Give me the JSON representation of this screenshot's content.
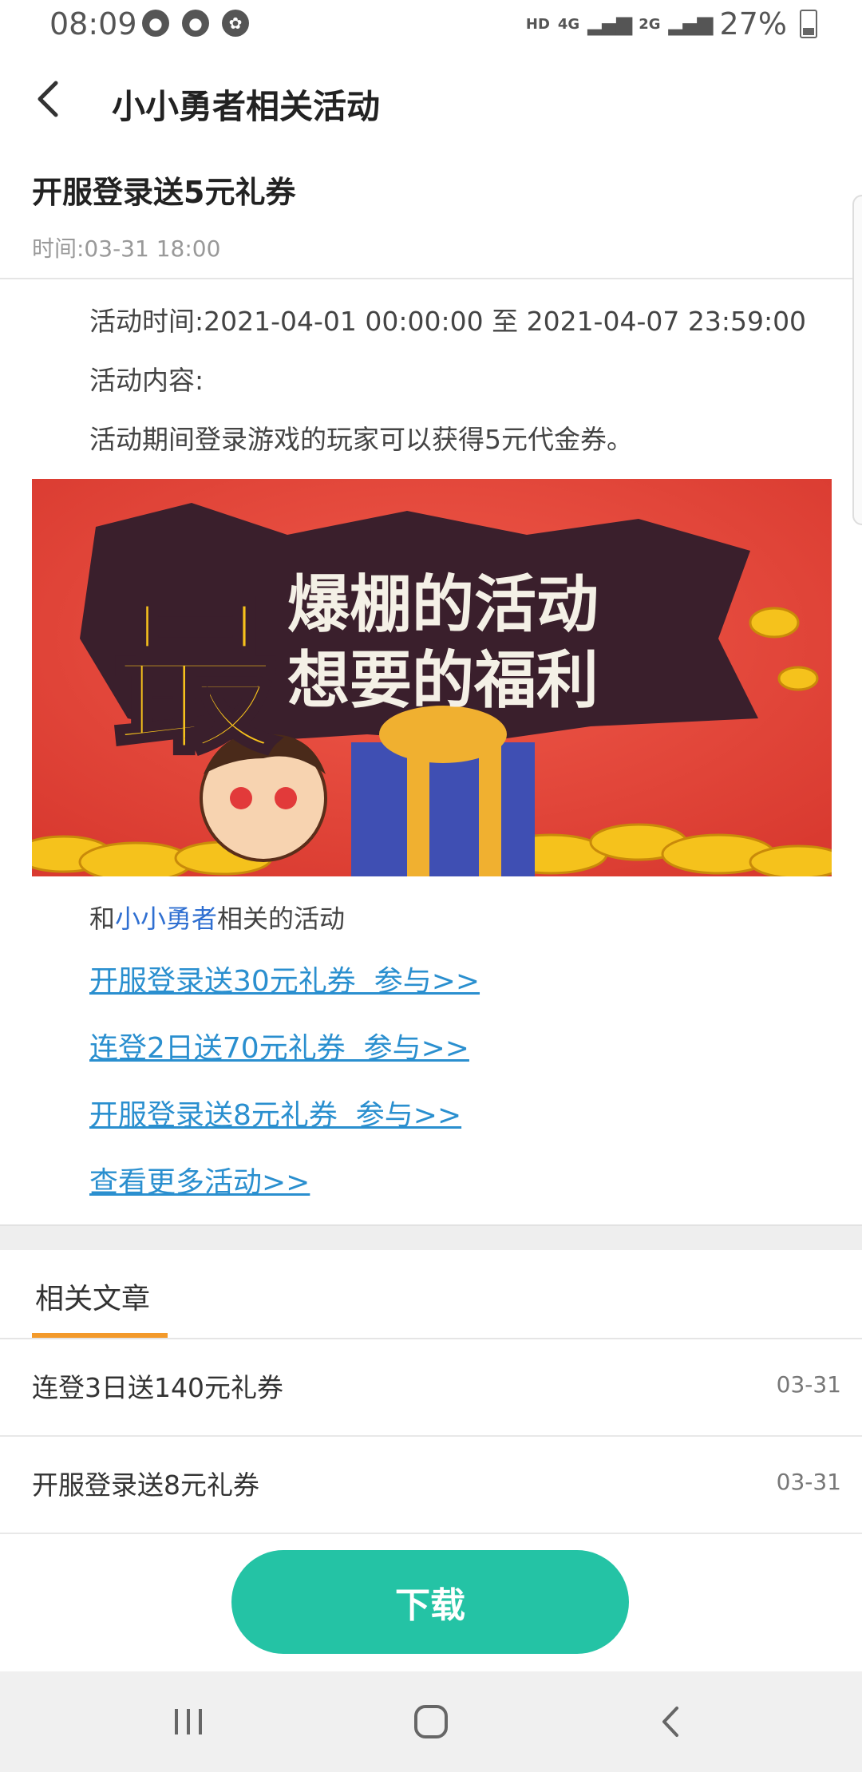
{
  "status_bar": {
    "time": "08:09",
    "hd": "HD",
    "net_4g": "4G",
    "net_2g": "2G",
    "battery": "27%",
    "icons": [
      "chat-bubble-icon",
      "chat-bubble-icon",
      "uc-browser-icon"
    ]
  },
  "header": {
    "back_icon": "chevron-left-icon",
    "title": "小小勇者相关活动"
  },
  "article": {
    "title": "开服登录送5元礼券",
    "time": "时间:03-31 18:00",
    "activity_time": "活动时间:2021-04-01 00:00:00 至 2021-04-07 23:59:00",
    "content_label": "活动内容:",
    "content": "活动期间登录游戏的玩家可以获得5元代金券。",
    "banner_line1_big": "最",
    "banner_line1": "爆棚的活动",
    "banner_line2": "想要的福利"
  },
  "related": {
    "prefix": "和",
    "game": "小小勇者",
    "suffix": "相关的活动",
    "links": [
      "开服登录送30元礼券  参与>>",
      "连登2日送70元礼券  参与>>",
      "开服登录送8元礼券  参与>>",
      "查看更多活动>>"
    ]
  },
  "articles_tab": {
    "label": "相关文章",
    "accent_color": "#f39a2b",
    "items": [
      {
        "title": "连登3日送140元礼券",
        "date": "03-31"
      },
      {
        "title": "开服登录送8元礼券",
        "date": "03-31"
      }
    ]
  },
  "download": {
    "label": "下载",
    "color": "#24c3a5"
  },
  "nav_bar": {
    "items": [
      "recent-apps-icon",
      "home-icon",
      "back-icon"
    ]
  }
}
